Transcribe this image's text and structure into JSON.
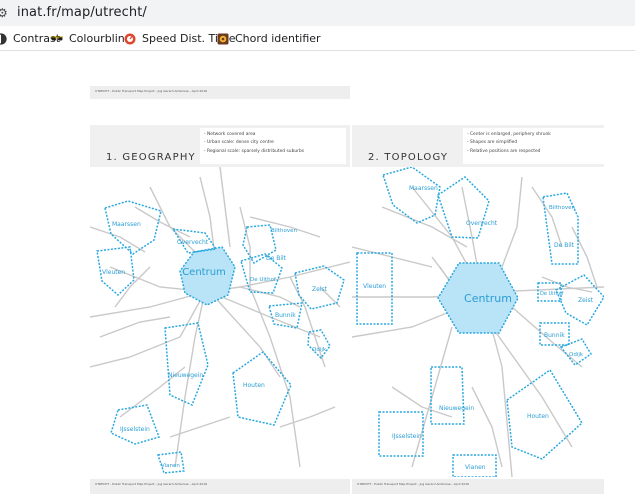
{
  "browser": {
    "url": "inat.fr/map/utrecht/",
    "bookmarks": [
      {
        "label": "Contrast",
        "icon": "contrast-icon"
      },
      {
        "label": "Colourblind",
        "icon": "sunglasses-icon"
      },
      {
        "label": "Speed Dist. Time",
        "icon": "speedometer-icon"
      },
      {
        "label": "Chord identifier",
        "icon": "chord-icon"
      }
    ]
  },
  "doc": {
    "header_text": "UTRECHT - Public Transport Map Project - Jug Gerard Ambroise - April 2016",
    "footer_text": "UTRECHT - Public Transport Map Project - Jug Gerard Ambroise - April 2016"
  },
  "geography": {
    "title": "1. GEOGRAPHY",
    "notes": [
      "- Network covered area",
      "- Urban scale: dense city centre",
      "- Regional scale: sparsely distributed suburbs"
    ],
    "places": {
      "centrum": "Centrum",
      "maarssen": "Maarssen",
      "overvecht": "Overvecht",
      "bilthoven": "Bilthoven",
      "debilt": "De Bilt",
      "vleuten": "Vleuten",
      "deuithof": "De Uithof",
      "zeist": "Zeist",
      "bunnik": "Bunnik",
      "odijk": "Odijk",
      "nieuwegein": "Nieuwegein",
      "houten": "Houten",
      "ijsselstein": "IJsselstein",
      "vianen": "Vianen"
    }
  },
  "topology": {
    "title": "2. TOPOLOGY",
    "notes": [
      "- Center is enlarged, periphery shrunk",
      "- Shapes are simplified",
      "- Relative positions are respected"
    ],
    "places": {
      "centrum": "Centrum",
      "maarssen": "Maarssen",
      "overvecht": "Overvecht",
      "bilthoven": "Bilthoven",
      "debilt": "De Bilt",
      "vleuten": "Vleuten",
      "deuithof": "De Uithof",
      "zeist": "Zeist",
      "bunnik": "Bunnik",
      "odijk": "Odijk",
      "nieuwegein": "Nieuwegein",
      "houten": "Houten",
      "ijsselstein": "IJsselstein",
      "vianen": "Vianen"
    }
  },
  "colors": {
    "accent": "#29a8e0",
    "fill": "#b9e3f6",
    "road": "#c9c9c9"
  }
}
